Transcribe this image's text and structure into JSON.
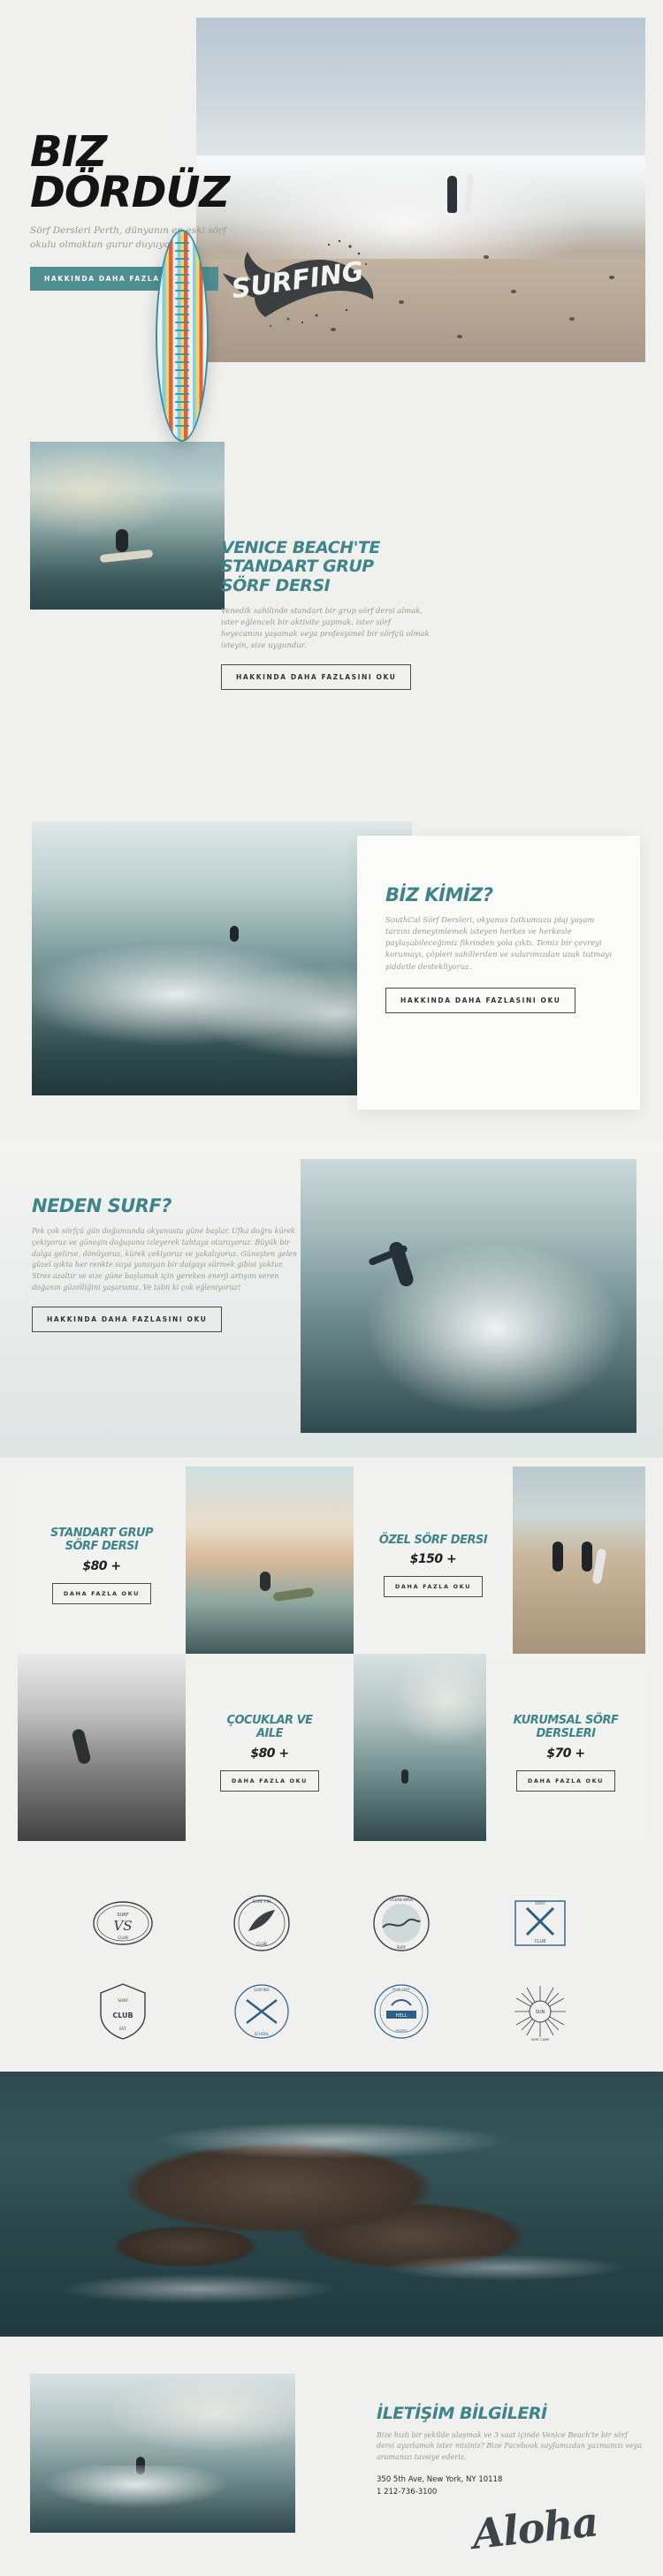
{
  "theme": {
    "page_bg": "#f0f0ee",
    "accent_teal": "#4f8f92",
    "heading_teal": "#3e8489",
    "body_text": "#9a9b86",
    "dark": "#2b2b2b",
    "card_bg": "#f2f2f0"
  },
  "hero": {
    "title": "BIZ DÖRDÜZ",
    "subtitle": "Sörf Dersleri Perth, dünyanın en eski sörf okulu olmaktan gurur duyuyor",
    "cta_label": "HAKKINDA DAHA FAZLASINI OKU",
    "image_alt": "surfer-on-beach-photo"
  },
  "lesson_section": {
    "logo_word": "SURFING",
    "logo_shape": "dolphin-icon",
    "surfboard_alt": "striped-surfboard-illustration",
    "side_image_alt": "surfer-paddling-photo",
    "heading_lines": [
      "VENICE BEACH'TE",
      "STANDART GRUP",
      "SÖRF DERSI"
    ],
    "body": "Venedik sahilinde standart bir grup sörf dersi almak, ister eğlenceli bir aktivite yapmak, ister sörf heyecanını yaşamak veya profesyonel bir sörfçü olmak isteyin, size uygundur.",
    "cta_label": "HAKKINDA DAHA FAZLASINI OKU"
  },
  "who_section": {
    "heading": "BİZ KİMİZ?",
    "body": "SouthCal Sörf Dersleri, okyanus tutkumuzu plaj yaşam tarzını deneyimlemek isteyen herkes ve herkesle paylaşabileceğimiz fikrinden yola çıktı. Temiz bir çevreyi korumayı, çöpleri sahillerden ve sularımızdan uzak tutmayı şiddetle destekliyoruz.",
    "cta_label": "HAKKINDA DAHA FAZLASINI OKU",
    "image_alt": "big-wave-ocean-photo"
  },
  "why_section": {
    "heading": "NEDEN SURF?",
    "body": "Pek çok sörfçü gün doğumunda okyanusta güne başlar. Ufka doğru kürek çekiyoruz ve güneşin doğuşunu izleyerek tahtaya oturuyoruz. Büyük bir dalga gelirse, dönüyoruz, kürek çekiyoruz ve yakalıyoruz. Güneşten gelen güzel ışıkta her renkte suya yansıyan bir dalgayı sürmek gibisi yoktur. Stres azaltır ve size güne başlamak için gereken enerji artışını veren doğanın güzelliğini yaşarsınız. Ve tabii ki çok eğleniyoruz!",
    "cta_label": "HAKKINDA DAHA FAZLASINI OKU",
    "image_alt": "surfer-carving-wave-photo"
  },
  "pricing": {
    "cards": [
      {
        "title_lines": [
          "STANDART GRUP",
          "SÖRF DERSI"
        ],
        "price": "$80 +",
        "cta_label": "DAHA FAZLA OKU",
        "image_alt": "surfer-sunset-photo"
      },
      {
        "title_lines": [
          "ÖZEL SÖRF DERSI"
        ],
        "price": "$150 +",
        "cta_label": "DAHA FAZLA OKU",
        "image_alt": "two-surfers-beach-photo"
      },
      {
        "title_lines": [
          "ÇOCUKLAR VE",
          "AILE"
        ],
        "price": "$80 +",
        "cta_label": "DAHA FAZLA OKU",
        "image_alt": "black-white-surfer-photo"
      },
      {
        "title_lines": [
          "KURUMSAL SÖRF",
          "DERSLERI"
        ],
        "price": "$70 +",
        "cta_label": "DAHA FAZLA OKU",
        "image_alt": "distant-surfer-wave-photo"
      }
    ]
  },
  "badges": {
    "row1": [
      {
        "name": "monogram-vs-badge",
        "top": "SURF",
        "center": "VS",
        "bottom": "CLUB"
      },
      {
        "name": "shark-fin-badge",
        "top": "SURF",
        "center": "FIN",
        "bottom": "CLUB"
      },
      {
        "name": "wave-circle-badge",
        "top": "OCEAN",
        "center": "WAVE",
        "bottom": "SURF"
      },
      {
        "name": "crossed-boards-club-badge",
        "top": "SURF",
        "center": "X",
        "bottom": "CLUB"
      }
    ],
    "row2": [
      {
        "name": "shield-club-badge",
        "top": "SURF",
        "center": "CLUB",
        "bottom": "EST"
      },
      {
        "name": "surfing-school-badge",
        "top": "SURFING",
        "center": "SCHOOL",
        "bottom": "WAVE"
      },
      {
        "name": "blue-surf-badge",
        "top": "BLUE SURF",
        "center": "HELL",
        "bottom": "RIDERS"
      },
      {
        "name": "sunburst-badge",
        "top": "SURF",
        "center": "SUN",
        "bottom": "CAMP"
      }
    ]
  },
  "aerial": {
    "image_alt": "aerial-rocks-ocean-photo"
  },
  "contact": {
    "heading": "İLETİŞİM BİLGİLERİ",
    "body": "Bize hızlı bir şekilde ulaşmak ve 3 saat içinde Venice Beach'te bir sörf dersi ayarlamak ister misiniz? Bize Facebook sayfamızdan yazmanızı veya aramanızı tavsiye ederiz.",
    "address": "350 5th Ave, New York, NY 10118",
    "phone": "1 212-736-3100",
    "signature": "Aloha",
    "image_alt": "surfer-riding-wave-photo"
  }
}
